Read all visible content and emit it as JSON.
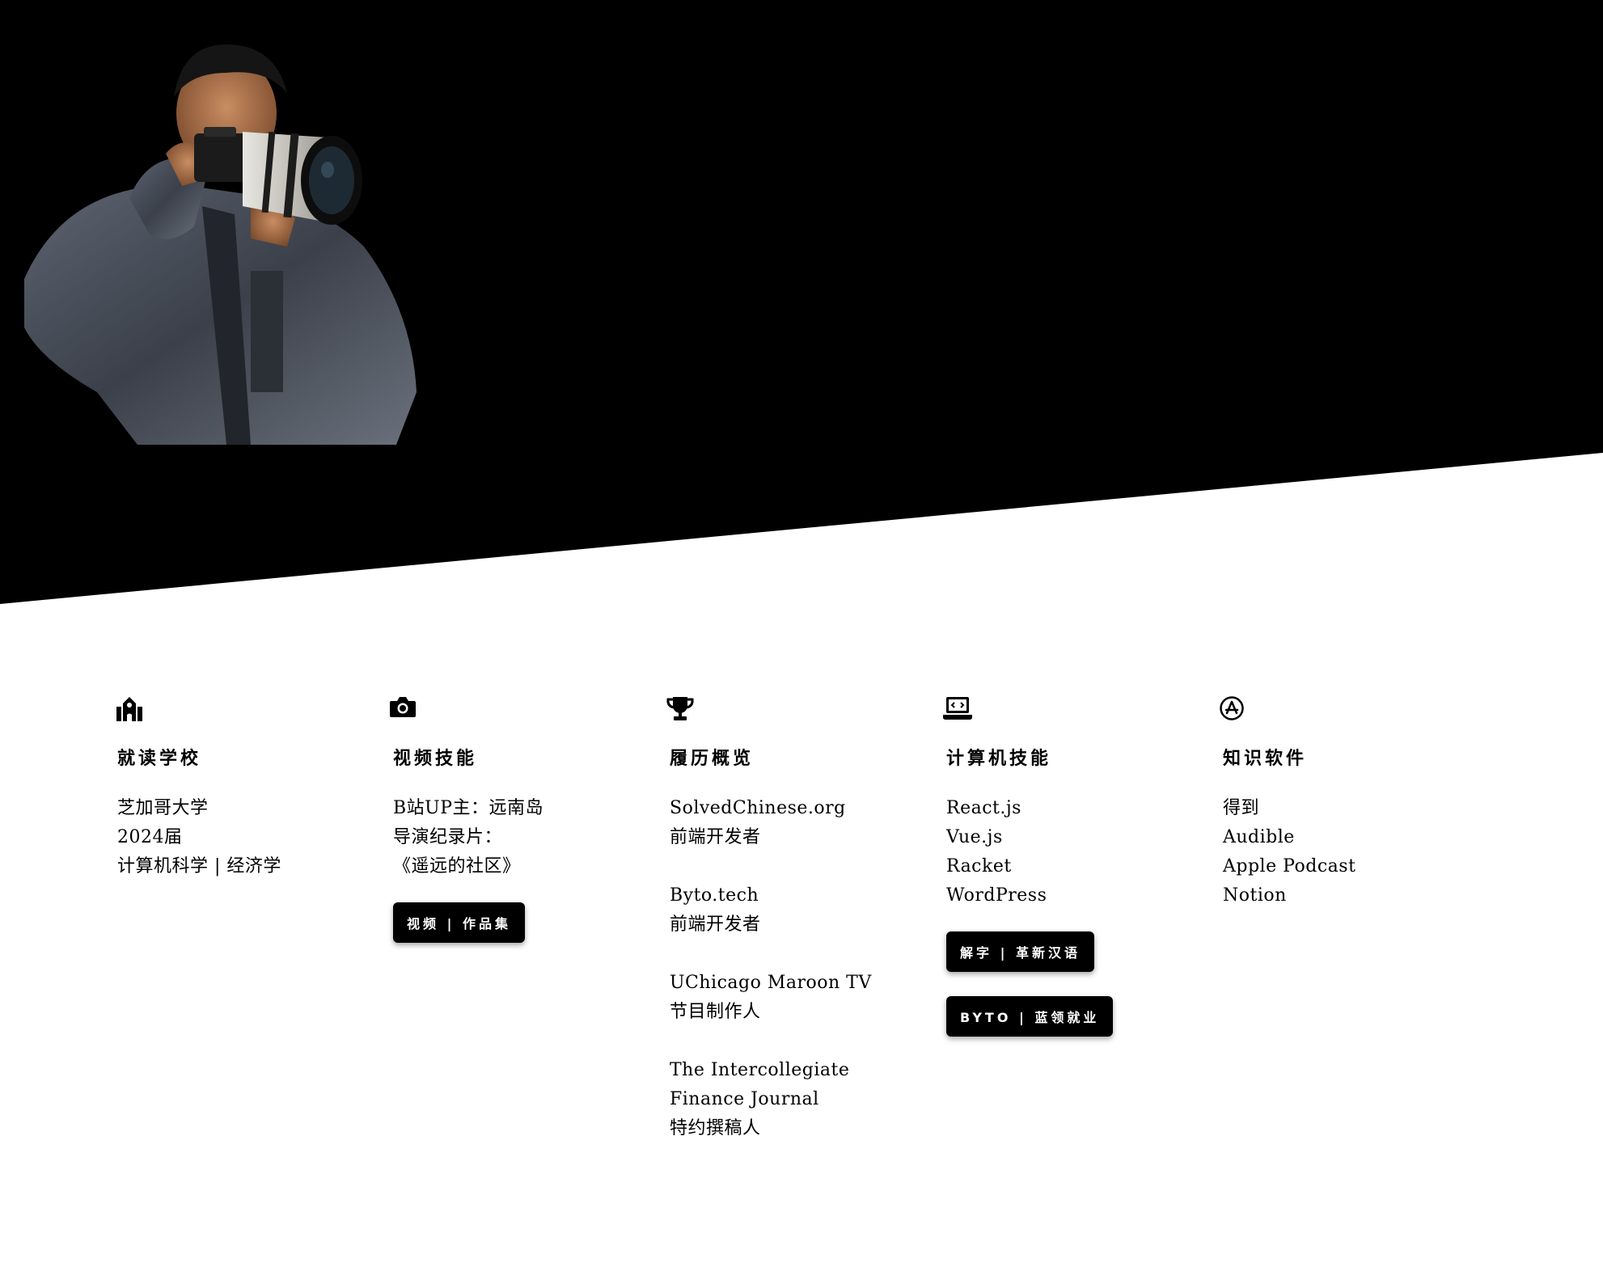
{
  "colors": {
    "hero_bg": "#000000",
    "page_bg": "#ffffff",
    "button_bg": "#000000",
    "button_text": "#ffffff"
  },
  "hero": {
    "photo": "photographer-with-camera"
  },
  "columns": [
    {
      "icon": "school-icon",
      "title": "就读学校",
      "lines": [
        "芝加哥大学",
        "2024届",
        "计算机科学 | 经济学"
      ]
    },
    {
      "icon": "camera-icon",
      "title": "视频技能",
      "lines": [
        "B站UP主：远南岛",
        "导演纪录片：",
        "《遥远的社区》"
      ],
      "buttons": [
        "视频 | 作品集"
      ]
    },
    {
      "icon": "trophy-icon",
      "title": "履历概览",
      "entries": [
        [
          "SolvedChinese.org",
          "前端开发者"
        ],
        [
          "Byto.tech",
          "前端开发者"
        ],
        [
          "UChicago Maroon TV",
          "节目制作人"
        ],
        [
          "The Intercollegiate",
          "Finance Journal",
          "特约撰稿人"
        ]
      ]
    },
    {
      "icon": "laptop-code-icon",
      "title": "计算机技能",
      "lines": [
        "React.js",
        "Vue.js",
        "Racket",
        "WordPress"
      ],
      "buttons": [
        "解字 | 革新汉语",
        "BYTO | 蓝领就业"
      ]
    },
    {
      "icon": "app-store-icon",
      "title": "知识软件",
      "lines": [
        "得到",
        "Audible",
        "Apple Podcast",
        "Notion"
      ]
    }
  ]
}
